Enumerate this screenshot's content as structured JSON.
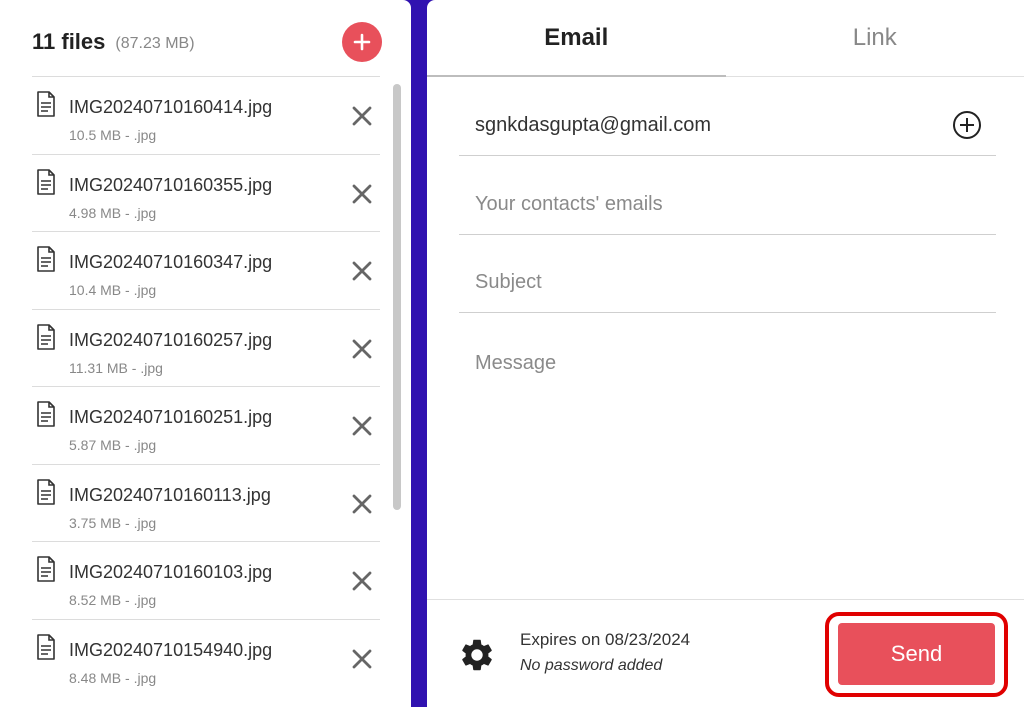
{
  "files_panel": {
    "count_label": "11 files",
    "total_size": "(87.23 MB)",
    "files": [
      {
        "name": "IMG20240710160414.jpg",
        "meta": "10.5 MB  -  .jpg"
      },
      {
        "name": "IMG20240710160355.jpg",
        "meta": "4.98 MB  -  .jpg"
      },
      {
        "name": "IMG20240710160347.jpg",
        "meta": "10.4 MB  -  .jpg"
      },
      {
        "name": "IMG20240710160257.jpg",
        "meta": "11.31 MB  -  .jpg"
      },
      {
        "name": "IMG20240710160251.jpg",
        "meta": "5.87 MB  -  .jpg"
      },
      {
        "name": "IMG20240710160113.jpg",
        "meta": "3.75 MB  -  .jpg"
      },
      {
        "name": "IMG20240710160103.jpg",
        "meta": "8.52 MB  -  .jpg"
      },
      {
        "name": "IMG20240710154940.jpg",
        "meta": "8.48 MB  -  .jpg"
      }
    ]
  },
  "tabs": [
    {
      "label": "Email"
    },
    {
      "label": "Link"
    }
  ],
  "form": {
    "to_value": "sgnkdasgupta@gmail.com",
    "contacts_placeholder": "Your contacts' emails",
    "subject_placeholder": "Subject",
    "message_placeholder": "Message"
  },
  "footer": {
    "expires": "Expires on 08/23/2024",
    "password": "No password added",
    "send_label": "Send"
  },
  "colors": {
    "accent": "#e8505b",
    "background": "#3012b0",
    "highlight": "#e00000"
  },
  "icons": {
    "add": "plus-icon",
    "file": "document-icon",
    "remove": "close-icon",
    "add_recipient": "circle-plus-icon",
    "settings": "gear-icon"
  }
}
